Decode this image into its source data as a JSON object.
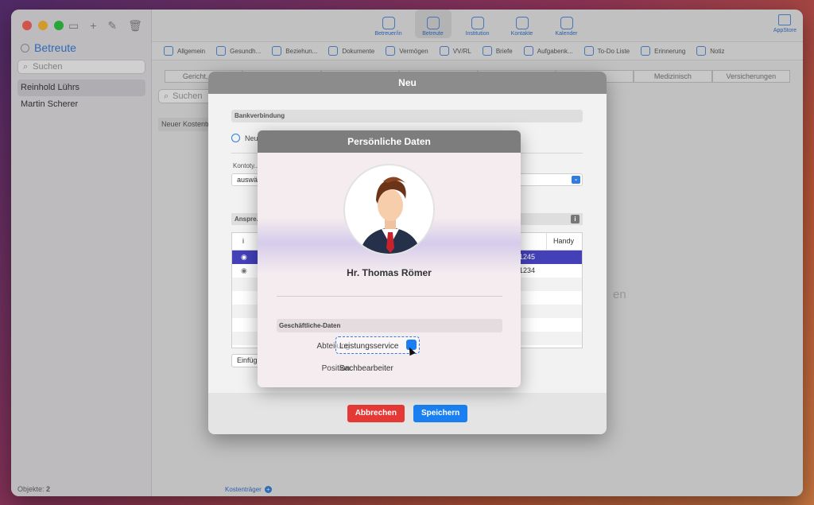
{
  "sidebar": {
    "title": "Betreute",
    "search_placeholder": "Suchen",
    "items": [
      {
        "label": "Reinhold Lührs",
        "selected": true
      },
      {
        "label": "Martin Scherer",
        "selected": false
      }
    ],
    "footer_label": "Objekte:",
    "footer_count": "2"
  },
  "toolbar": {
    "buttons": [
      {
        "label": "Betreuer/in",
        "icon": "person-icon"
      },
      {
        "label": "Betreute",
        "icon": "person-filled-icon",
        "selected": true
      },
      {
        "label": "Institution",
        "icon": "bank-icon"
      },
      {
        "label": "Kontakte",
        "icon": "at-icon"
      },
      {
        "label": "Kalender",
        "icon": "alarm-clock-icon"
      }
    ],
    "appstore_label": "AppStore"
  },
  "tabs": [
    {
      "label": "Allgemein",
      "icon": "person-icon"
    },
    {
      "label": "Gesundh...",
      "icon": "medical-icon"
    },
    {
      "label": "Beziehun...",
      "icon": "people-icon"
    },
    {
      "label": "Dokumente",
      "icon": "folder-icon"
    },
    {
      "label": "Vermögen",
      "icon": "euro-icon"
    },
    {
      "label": "VV/RL",
      "icon": "chart-icon"
    },
    {
      "label": "Briefe",
      "icon": "document-icon"
    },
    {
      "label": "Aufgabenk...",
      "icon": "gear-doc-icon"
    },
    {
      "label": "To-Do Liste",
      "icon": "check-circle-icon"
    },
    {
      "label": "Erinnerung",
      "icon": "bell-icon"
    },
    {
      "label": "Notiz",
      "icon": "note-icon"
    }
  ],
  "subtabs": [
    "Gericht, Be...",
    "",
    "",
    "",
    "",
    "",
    "Medizinisch",
    "Versicherungen"
  ],
  "middle": {
    "search_placeholder": "Suchen",
    "row_label": "Neuer Kostentr...",
    "footer_label": "Kostenträger"
  },
  "background_word": "en",
  "sheet": {
    "title": "Neu",
    "bank_section": "Bankverbindung",
    "radio_label": "Neu",
    "konto_label": "Kontoty...",
    "konto_value": "auswä...",
    "ansp_label": "Anspre...",
    "table_header_1": "i",
    "table_header_2": "Handy",
    "rows": [
      {
        "value": "-1245",
        "selected": true
      },
      {
        "value": "-1234",
        "selected": false
      }
    ],
    "insert_label": "Einfüg...",
    "cancel_label": "Abbrechen",
    "save_label": "Speichern"
  },
  "popover": {
    "title": "Persönliche Daten",
    "name": "Hr. Thomas Römer",
    "section": "Geschäftliche-Daten",
    "dept_label": "Abteilung:",
    "dept_value": "Leistungsservice",
    "position_label": "Position:",
    "position_value": "Sachbearbeiter"
  },
  "colors": {
    "accent": "#2f7de1",
    "selection": "#4440b8",
    "cancel": "#e53935",
    "save": "#1a7ff0"
  }
}
